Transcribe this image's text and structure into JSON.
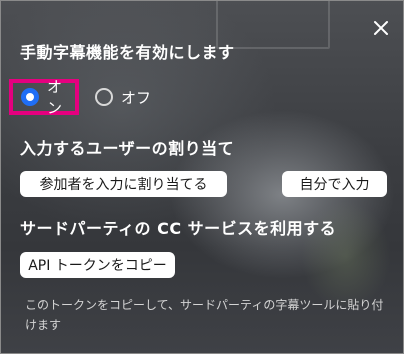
{
  "dialog": {
    "close_icon": "close-icon",
    "section_manual": {
      "title": "手動字幕機能を有効にします",
      "options": [
        {
          "label": "オン",
          "selected": true
        },
        {
          "label": "オフ",
          "selected": false
        }
      ],
      "highlight_color": "#e5007f",
      "accent_color": "#1f6ef5"
    },
    "section_assign": {
      "title": "入力するユーザーの割り当て",
      "assign_button": "参加者を入力に割り当てる",
      "self_button": "自分で入力"
    },
    "section_third_party": {
      "title": "サードパーティの CC サービスを利用する",
      "copy_button": "API トークンをコピー",
      "description": "このトークンをコピーして、サードパーティの字幕ツールに貼り付けます"
    }
  }
}
